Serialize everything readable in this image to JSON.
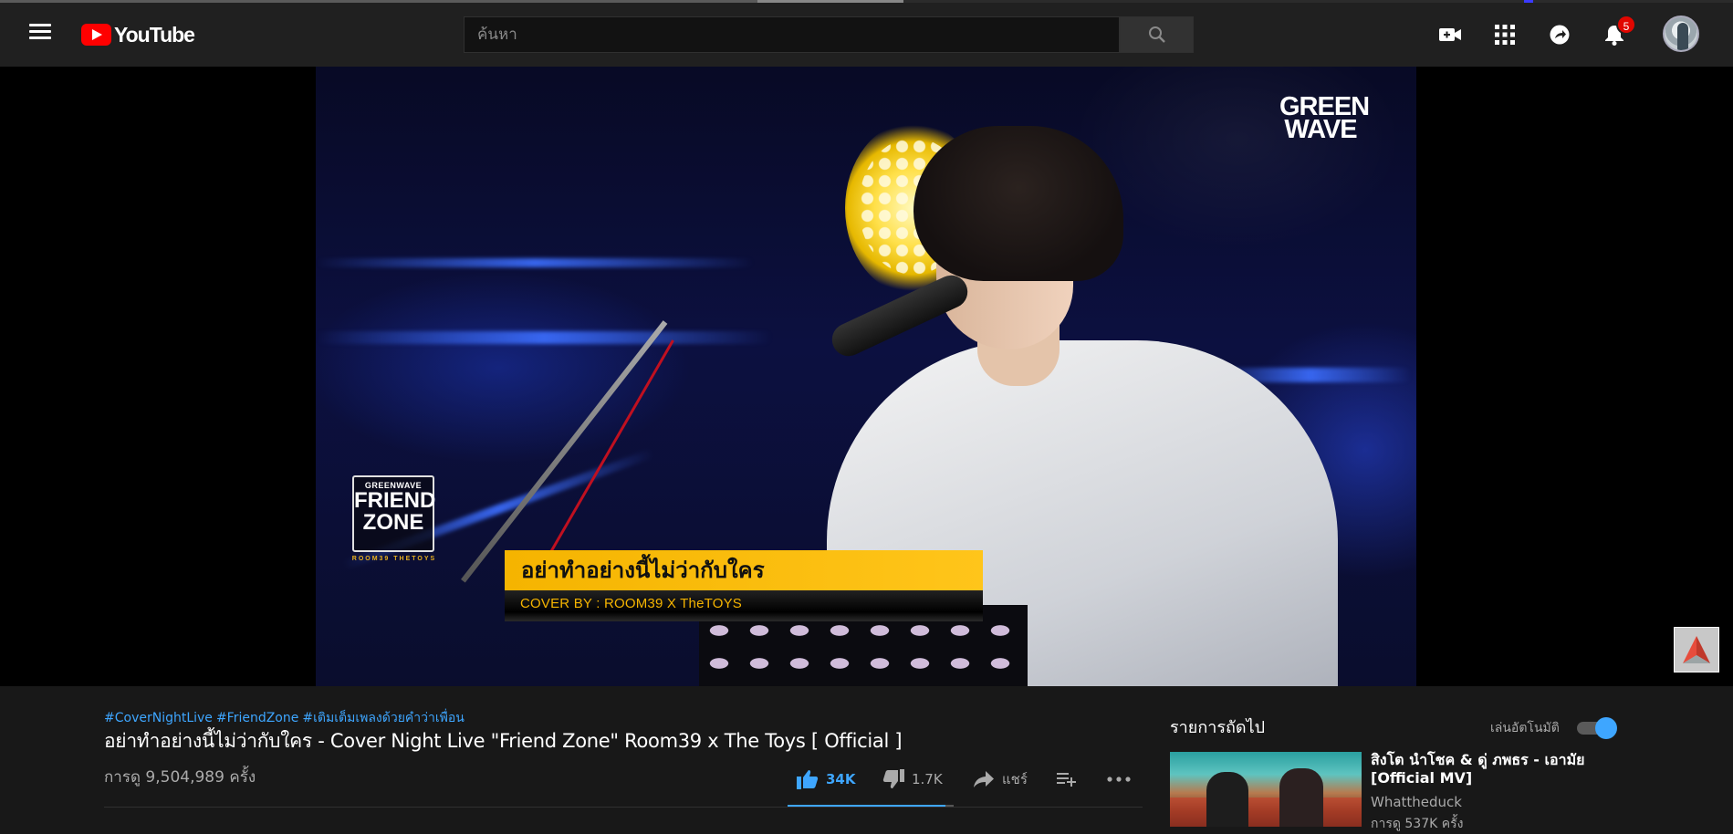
{
  "masthead": {
    "logo_text": "YouTube",
    "search_placeholder": "ค้นหา",
    "notification_count": "5"
  },
  "player": {
    "overlay_brand": [
      "GREEN",
      "WAVE"
    ],
    "show_logo_small": "GREENWAVE",
    "show_logo_line1": "FRIEND",
    "show_logo_line2": "ZONE",
    "show_logo_sub": "ROOM39  THETOYS",
    "lower_third_title": "อย่าทำอย่างนี้ไม่ว่ากับใคร",
    "lower_third_sub": "COVER BY : ROOM39 X TheTOYS"
  },
  "video": {
    "hashtags": [
      "#CoverNightLive",
      "#FriendZone",
      "#เติมเต็มเพลงด้วยคำว่าเพื่อน"
    ],
    "title": "อย่าทำอย่างนี้ไม่ว่ากับใคร - Cover Night Live \"Friend Zone\" Room39 x The Toys [ Official ]",
    "views": "การดู 9,504,989 ครั้ง",
    "likes": "34K",
    "dislikes": "1.7K",
    "share_label": "แชร์",
    "like_ratio": 0.952
  },
  "sidebar": {
    "up_next_label": "รายการถัดไป",
    "autoplay_label": "เล่นอัตโนมัติ",
    "autoplay_on": true,
    "recommendation": {
      "title": "สิงโต นำโชค & ดู่ ภพธร - เอามัย [Official MV]",
      "channel": "Whattheduck",
      "views": "การดู 537K ครั้ง"
    }
  },
  "colors": {
    "accent": "#3ea6ff",
    "brand_red": "#ff0000",
    "lower_third_yellow": "#f5b400",
    "background": "#181818",
    "masthead": "#202020"
  }
}
